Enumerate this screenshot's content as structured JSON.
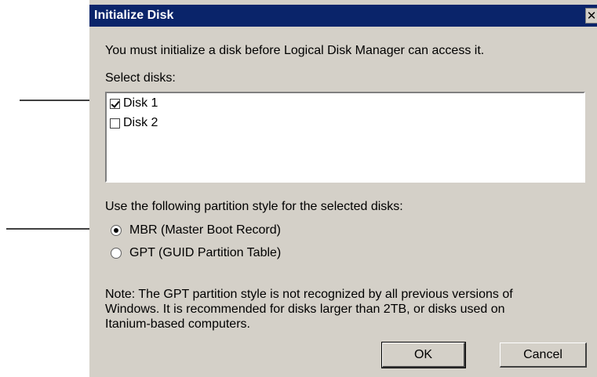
{
  "dialog": {
    "title": "Initialize Disk",
    "close_glyph": "✕",
    "intro": "You must initialize a disk before Logical Disk Manager can access it.",
    "select_label": "Select disks:",
    "disks": [
      {
        "label": "Disk 1",
        "checked": true
      },
      {
        "label": "Disk 2",
        "checked": false
      }
    ],
    "partition_label": "Use the following partition style for the selected disks:",
    "partition_options": [
      {
        "label": "MBR (Master Boot Record)",
        "selected": true
      },
      {
        "label": "GPT (GUID Partition Table)",
        "selected": false
      }
    ],
    "note": "Note: The GPT partition style is not recognized by all previous versions of\nWindows. It is recommended for disks larger than 2TB, or disks used on\nItanium-based computers.",
    "ok_label": "OK",
    "cancel_label": "Cancel"
  },
  "annotations": {
    "arrow_color": "#000000"
  }
}
